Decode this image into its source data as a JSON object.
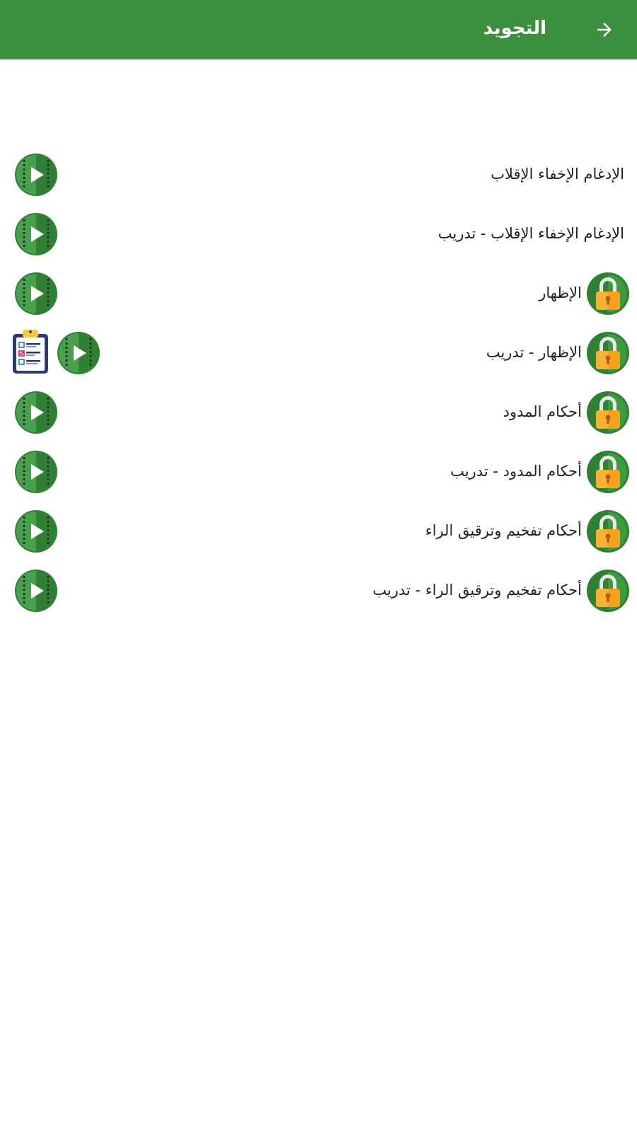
{
  "appbar": {
    "title": "التجويد",
    "back_icon": "arrow-forward-icon",
    "background": "#3b8f3e"
  },
  "lessons": [
    {
      "label": "الإدغام الإخفاء الإقلاب",
      "locked": false,
      "video": true,
      "quiz": false
    },
    {
      "label": "الإدغام الإخفاء الإقلاب - تدريب",
      "locked": false,
      "video": true,
      "quiz": false
    },
    {
      "label": "الإظهار",
      "locked": true,
      "video": true,
      "quiz": false
    },
    {
      "label": "الإظهار - تدريب",
      "locked": true,
      "video": true,
      "quiz": true
    },
    {
      "label": "أحكام المدود",
      "locked": true,
      "video": true,
      "quiz": false
    },
    {
      "label": "أحكام المدود - تدريب",
      "locked": true,
      "video": true,
      "quiz": false
    },
    {
      "label": "أحكام تفخيم وترقيق الراء",
      "locked": true,
      "video": true,
      "quiz": false
    },
    {
      "label": "أحكام تفخيم وترقيق الراء - تدريب",
      "locked": true,
      "video": true,
      "quiz": false
    }
  ],
  "icons": {
    "lock": "lock-icon",
    "play": "play-video-icon",
    "quiz": "quiz-clipboard-icon"
  },
  "colors": {
    "green": "#3b8f3e",
    "lock_body": "#f6a21c"
  }
}
